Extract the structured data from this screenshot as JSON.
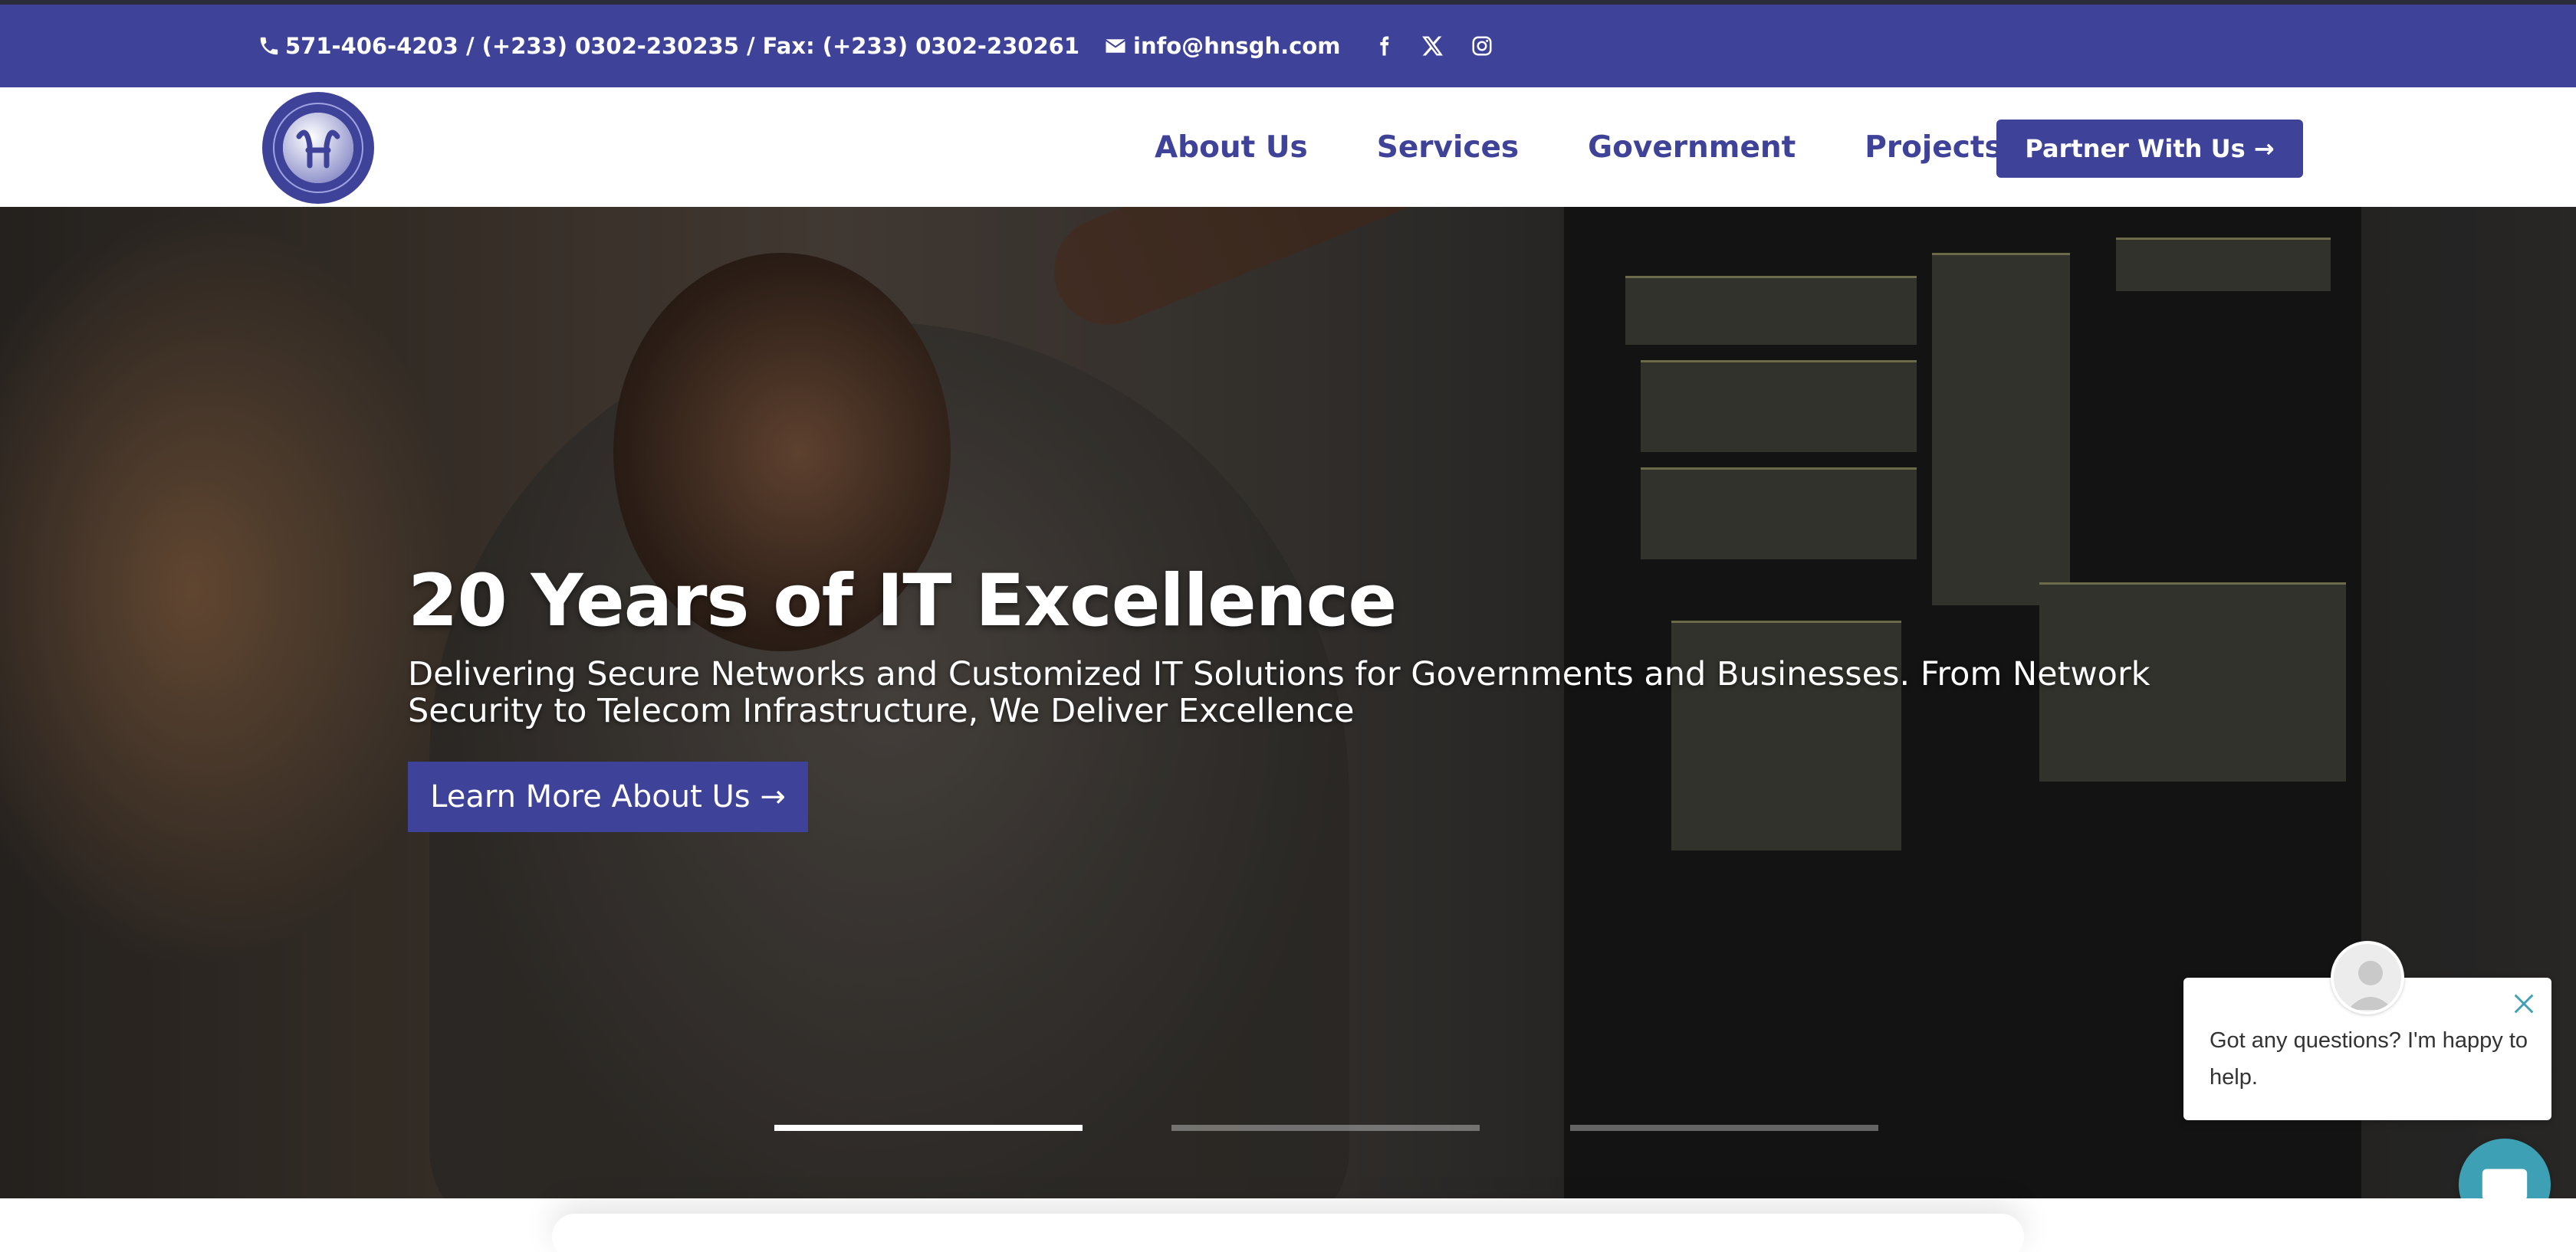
{
  "topbar": {
    "phones": "571-406-4203 / (+233) 0302-230235 / Fax: (+233) 0302-230261",
    "email": "info@hnsgh.com",
    "social": [
      "facebook-icon",
      "x-icon",
      "instagram-icon"
    ]
  },
  "nav": {
    "items": [
      {
        "label": "About Us"
      },
      {
        "label": "Services"
      },
      {
        "label": "Government"
      },
      {
        "label": "Projects"
      }
    ],
    "cta_label": "Partner With Us →"
  },
  "hero": {
    "title": "20 Years of IT Excellence",
    "subtitle": "Delivering Secure Networks and Customized IT Solutions for Governments and Businesses. From Network Security to Telecom Infrastructure, We Deliver Excellence",
    "button_label": "Learn More About Us →",
    "slides_total": 3,
    "active_slide": 1
  },
  "chat": {
    "message": "Got any questions? I'm happy to help."
  },
  "colors": {
    "brand": "#3f4299",
    "white": "#ffffff",
    "chat": "#3da0b5"
  }
}
